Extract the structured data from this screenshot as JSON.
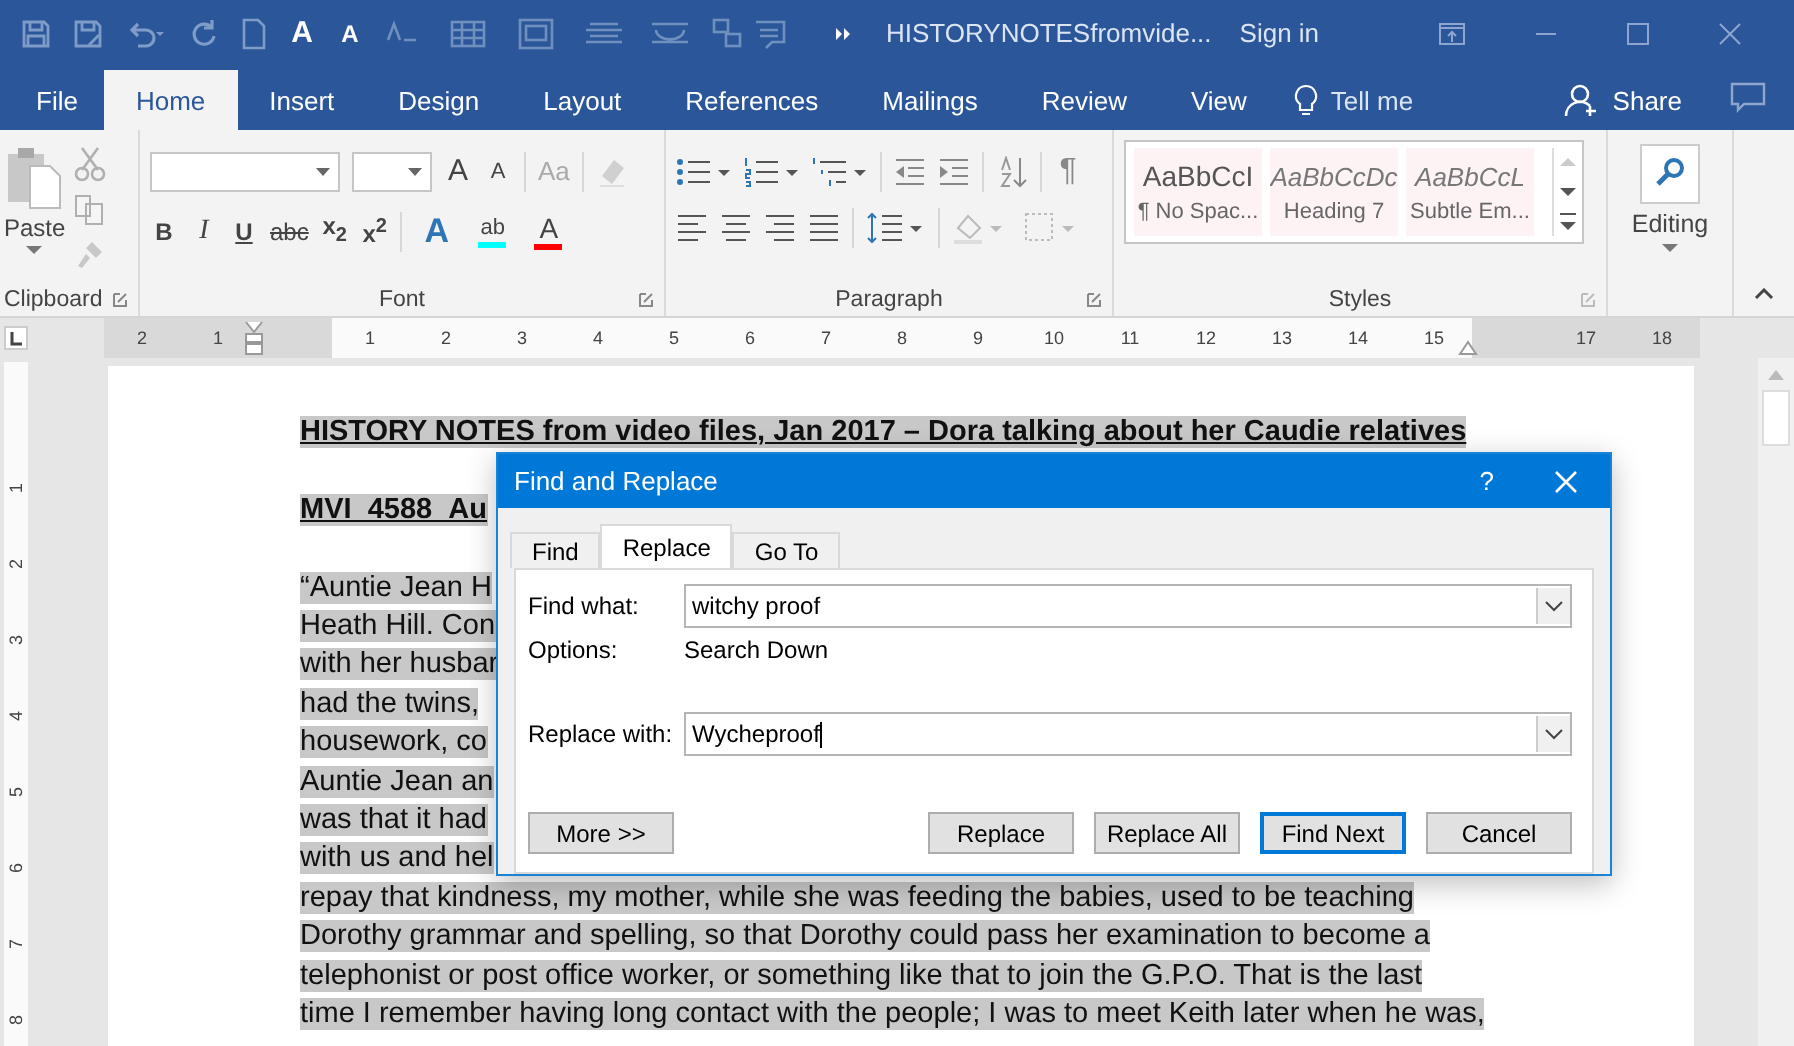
{
  "title_bar": {
    "quick_access_glyphs": [
      "A",
      "A"
    ],
    "document_title": "HISTORYNOTESfromvide...",
    "sign_in": "Sign in"
  },
  "tabs": [
    {
      "label": "File",
      "selected": false
    },
    {
      "label": "Home",
      "selected": true
    },
    {
      "label": "Insert",
      "selected": false
    },
    {
      "label": "Design",
      "selected": false
    },
    {
      "label": "Layout",
      "selected": false
    },
    {
      "label": "References",
      "selected": false
    },
    {
      "label": "Mailings",
      "selected": false
    },
    {
      "label": "Review",
      "selected": false
    },
    {
      "label": "View",
      "selected": false
    }
  ],
  "tell_me": "Tell me",
  "share": "Share",
  "ribbon": {
    "clipboard": {
      "paste": "Paste",
      "label": "Clipboard"
    },
    "font": {
      "label": "Font",
      "row1_glyphs": [
        "A",
        "A",
        "Aa"
      ],
      "format_glyphs": [
        "B",
        "I",
        "U",
        "abc",
        "x$_{2}$",
        "x$^{2}$"
      ],
      "effect_glyphs": [
        "A",
        "ab",
        "A"
      ]
    },
    "paragraph": {
      "label": "Paragraph",
      "pilcrow": "¶"
    },
    "styles": {
      "label": "Styles",
      "items": [
        {
          "preview": "AaBbCcI",
          "name": "¶ No Spac...",
          "kind": "plain"
        },
        {
          "preview": "AaBbCcDc",
          "name": "Heading 7",
          "kind": "italic"
        },
        {
          "preview": "AaBbCcL",
          "name": "Subtle Em...",
          "kind": "italic"
        }
      ]
    },
    "editing": {
      "label": "Editing"
    }
  },
  "ruler": {
    "left_numbers": [
      "2",
      "1"
    ],
    "numbers": [
      "1",
      "2",
      "3",
      "4",
      "5",
      "6",
      "7",
      "8",
      "9",
      "10",
      "11",
      "12",
      "13",
      "14",
      "15"
    ],
    "right_numbers": [
      "17",
      "18"
    ],
    "vertical_numbers": [
      "1",
      "2",
      "3",
      "4",
      "5",
      "6",
      "7",
      "8"
    ]
  },
  "document": {
    "lines": [
      {
        "kind": "heading",
        "text": "HISTORY NOTES from video files, Jan 2017 – Dora talking about her Caudie relatives"
      },
      {
        "kind": "heading",
        "text": "MVI_4588_Au"
      },
      {
        "kind": "body",
        "text": "“Auntie Jean H"
      },
      {
        "kind": "body",
        "text": "Heath Hill. Con"
      },
      {
        "kind": "body",
        "text": "with her husbar"
      },
      {
        "kind": "body",
        "text": "had the twins,"
      },
      {
        "kind": "body",
        "text": "housework, co"
      },
      {
        "kind": "body",
        "text": "Auntie Jean an"
      },
      {
        "kind": "body",
        "text": "was that it had"
      },
      {
        "kind": "body",
        "text": "with us and hel"
      },
      {
        "kind": "body",
        "text": "repay that kindness, my mother, while she was feeding the babies, used to be teaching"
      },
      {
        "kind": "body",
        "text": "Dorothy grammar and spelling, so that Dorothy could pass her examination to become a"
      },
      {
        "kind": "body",
        "text": "telephonist or post office worker, or something like that to join the G.P.O. That is the last"
      },
      {
        "kind": "body",
        "text": "time I remember having long contact with the people; I was to meet Keith later when he was,"
      }
    ]
  },
  "dialog": {
    "title": "Find and Replace",
    "help": "?",
    "tabs": [
      {
        "label": "Find",
        "selected": false
      },
      {
        "label": "Replace",
        "selected": true
      },
      {
        "label": "Go To",
        "selected": false
      }
    ],
    "find_what": {
      "label": "Find what:",
      "value": "witchy proof"
    },
    "options": {
      "label": "Options:",
      "value": "Search Down"
    },
    "replace_with": {
      "label": "Replace with:",
      "value": "Wycheproof"
    },
    "buttons": [
      {
        "label": "More >>",
        "default": false
      },
      {
        "label": "Replace",
        "default": false
      },
      {
        "label": "Replace All",
        "default": false
      },
      {
        "label": "Find Next",
        "default": true
      },
      {
        "label": "Cancel",
        "default": false
      }
    ]
  }
}
